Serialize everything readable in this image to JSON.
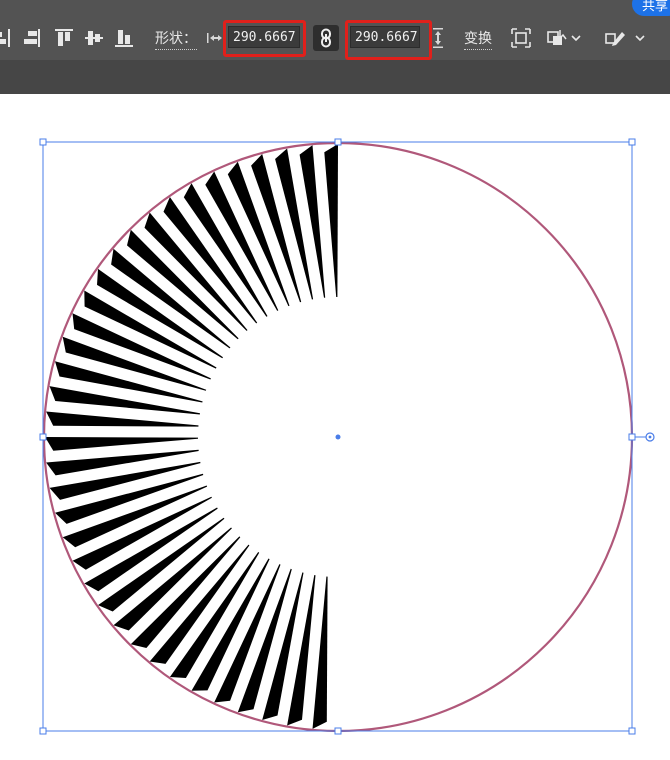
{
  "toolbar": {
    "share_label": "共享",
    "shape_label": "形状：",
    "width_value": "290.6667 p",
    "height_value": "290.6667 p",
    "transform_label": "变换",
    "icons": {
      "align_left": "align-left-icon",
      "align_right": "align-right-icon",
      "align_top": "align-top-icon",
      "align_vcenter": "align-vertical-center-icon",
      "align_bottom": "align-bottom-icon",
      "width": "width-arrows-icon",
      "link": "constrain-proportions-link-icon",
      "height": "height-arrows-icon",
      "isolate": "isolate-object-icon",
      "arrange": "arrange-dropdown-icon",
      "edit": "edit-toolbar-dropdown-icon"
    },
    "highlight_color": "#e0201b",
    "bar_color": "#535353"
  },
  "canvas": {
    "background": "#ffffff",
    "circle_stroke_color": "#b0587a",
    "selection_color": "#4a7de8",
    "spike_color": "#000000"
  }
}
